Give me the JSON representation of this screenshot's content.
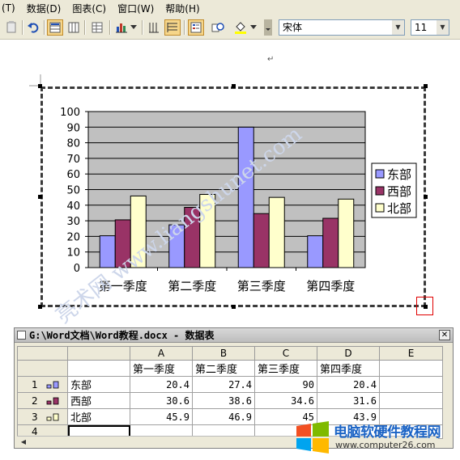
{
  "menubar": {
    "items": [
      "(T)",
      "数据(D)",
      "图表(C)",
      "窗口(W)",
      "帮助(H)"
    ]
  },
  "toolbar": {
    "font_name": "宋体",
    "font_size": "11",
    "icons": [
      "paste-icon",
      "undo-icon",
      "by-row-icon",
      "by-column-icon",
      "table-icon",
      "chart-type-icon",
      "dropdown-icon",
      "vertical-gridlines-icon",
      "horizontal-gridlines-icon",
      "legend-icon",
      "format-icon",
      "fill-color-icon"
    ]
  },
  "document": {
    "paragraph_mark": "↵",
    "watermark": "亮术网 www.liangshunet.com"
  },
  "chart_data": {
    "type": "bar",
    "categories": [
      "第一季度",
      "第二季度",
      "第三季度",
      "第四季度"
    ],
    "series": [
      {
        "name": "东部",
        "values": [
          20.4,
          27.4,
          90,
          20.4
        ],
        "color": "#9999ff"
      },
      {
        "name": "西部",
        "values": [
          30.6,
          38.6,
          34.6,
          31.6
        ],
        "color": "#993366"
      },
      {
        "name": "北部",
        "values": [
          45.9,
          46.9,
          45,
          43.9
        ],
        "color": "#ffffcc"
      }
    ],
    "yticks": [
      "100",
      "90",
      "80",
      "70",
      "60",
      "50",
      "40",
      "30",
      "20",
      "10",
      "0"
    ],
    "ylim": [
      0,
      100
    ],
    "grid": true,
    "plot_background": "#c0c0c0",
    "legend_position": "right"
  },
  "datasheet": {
    "title": "G:\\Word文档\\Word教程.docx - 数据表",
    "close_glyph": "✕",
    "col_letters": [
      "A",
      "B",
      "C",
      "D",
      "E"
    ],
    "header_row": [
      "第一季度",
      "第二季度",
      "第三季度",
      "第四季度",
      ""
    ],
    "rows": [
      {
        "num": "1",
        "label": "东部",
        "values": [
          "20.4",
          "27.4",
          "90",
          "20.4",
          ""
        ]
      },
      {
        "num": "2",
        "label": "西部",
        "values": [
          "30.6",
          "38.6",
          "34.6",
          "31.6",
          ""
        ]
      },
      {
        "num": "3",
        "label": "北部",
        "values": [
          "45.9",
          "46.9",
          "45",
          "43.9",
          ""
        ]
      },
      {
        "num": "4",
        "label": "",
        "values": [
          "",
          "",
          "",
          "",
          ""
        ]
      }
    ]
  },
  "brand": {
    "name": "电脑软硬件教程网",
    "url": "www.computer26.com"
  }
}
